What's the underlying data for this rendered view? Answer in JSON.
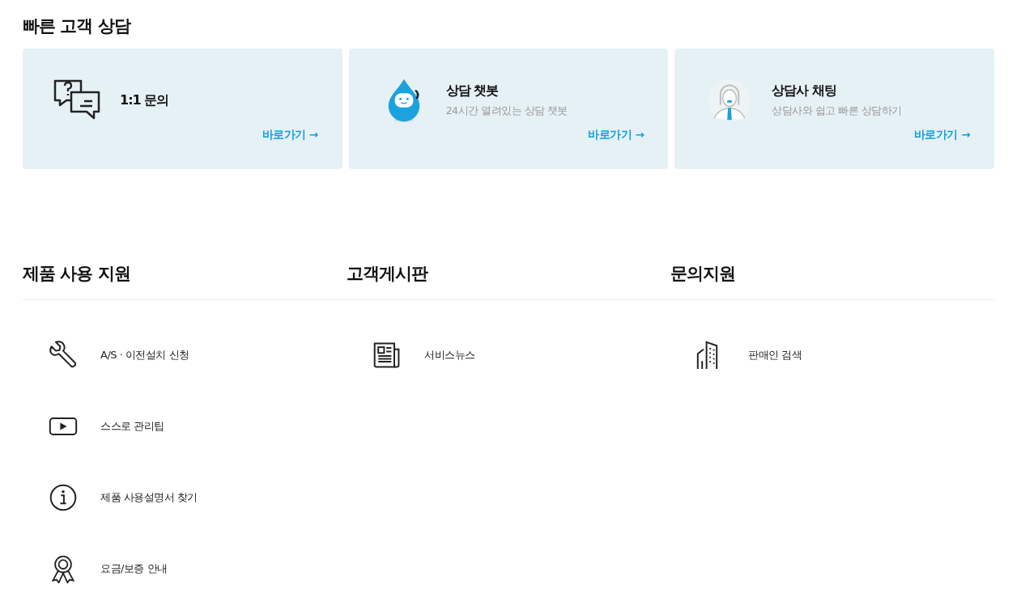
{
  "quick_consult": {
    "title": "빠른 고객 상담",
    "cards": [
      {
        "kind": "inquiry",
        "title": "1:1 문의",
        "link": "바로가기 →"
      },
      {
        "kind": "chatbot",
        "title": "상담 챗봇",
        "subtitle": "24시간 열려있는 상담 챗봇",
        "link": "바로가기 →"
      },
      {
        "kind": "agent",
        "title": "상담사 채팅",
        "subtitle": "상담사와 쉽고 빠른 상담하기",
        "link": "바로가기 →"
      }
    ]
  },
  "support": {
    "columns": [
      {
        "title": "제품 사용 지원",
        "items": [
          {
            "kind": "wrench",
            "label": "A/S · 이전설치 신청"
          },
          {
            "kind": "video",
            "label": "스스로 관리팁"
          },
          {
            "kind": "info",
            "label": "제품 사용설명서 찾기"
          },
          {
            "kind": "award",
            "label": "요금/보증 안내"
          }
        ]
      },
      {
        "title": "고객게시판",
        "items": [
          {
            "kind": "news",
            "label": "서비스뉴스"
          }
        ]
      },
      {
        "title": "문의지원",
        "items": [
          {
            "kind": "building",
            "label": "판매인 검색"
          }
        ]
      }
    ]
  }
}
